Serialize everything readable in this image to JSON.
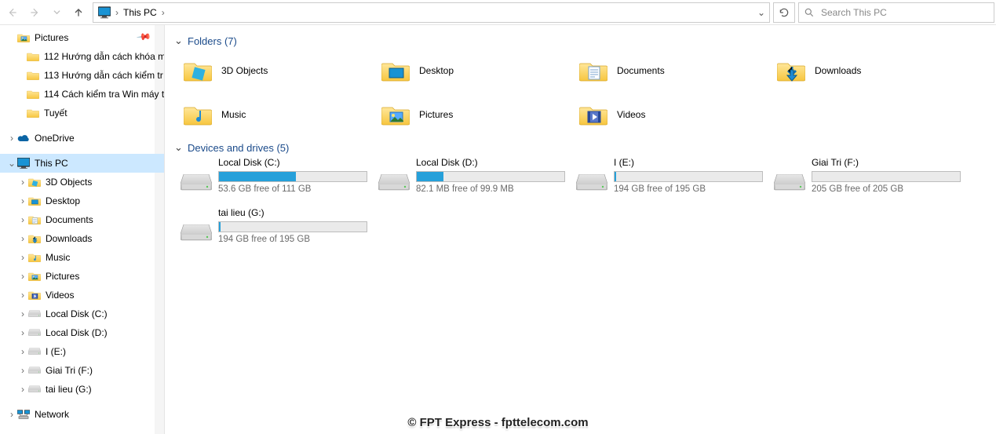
{
  "address": {
    "location_label": "This PC",
    "search_placeholder": "Search This PC"
  },
  "sidebar": {
    "pictures_label": "Pictures",
    "quick_items": [
      {
        "label": "112 Hướng dẫn cách khóa m"
      },
      {
        "label": "113 Hướng dẫn cách kiểm tr"
      },
      {
        "label": "114 Cách kiểm tra Win máy t"
      },
      {
        "label": "Tuyết"
      }
    ],
    "onedrive_label": "OneDrive",
    "this_pc_label": "This PC",
    "this_pc_children": [
      {
        "label": "3D Objects",
        "kind": "3d"
      },
      {
        "label": "Desktop",
        "kind": "desktop"
      },
      {
        "label": "Documents",
        "kind": "docs"
      },
      {
        "label": "Downloads",
        "kind": "downloads"
      },
      {
        "label": "Music",
        "kind": "music"
      },
      {
        "label": "Pictures",
        "kind": "pictures"
      },
      {
        "label": "Videos",
        "kind": "videos"
      },
      {
        "label": "Local Disk (C:)",
        "kind": "drive-c"
      },
      {
        "label": "Local Disk (D:)",
        "kind": "drive"
      },
      {
        "label": "I (E:)",
        "kind": "drive"
      },
      {
        "label": "Giai Tri (F:)",
        "kind": "drive"
      },
      {
        "label": "tai lieu (G:)",
        "kind": "drive"
      }
    ],
    "network_label": "Network"
  },
  "groups": {
    "folders_header": "Folders (7)",
    "drives_header": "Devices and drives (5)"
  },
  "folders": [
    {
      "label": "3D Objects",
      "kind": "3d"
    },
    {
      "label": "Desktop",
      "kind": "desktop"
    },
    {
      "label": "Documents",
      "kind": "docs"
    },
    {
      "label": "Downloads",
      "kind": "downloads"
    },
    {
      "label": "Music",
      "kind": "music"
    },
    {
      "label": "Pictures",
      "kind": "pictures"
    },
    {
      "label": "Videos",
      "kind": "videos"
    }
  ],
  "drives": [
    {
      "name": "Local Disk (C:)",
      "space": "53.6 GB free of 111 GB",
      "fill_pct": 52,
      "os": true
    },
    {
      "name": "Local Disk (D:)",
      "space": "82.1 MB free of 99.9 MB",
      "fill_pct": 18,
      "os": false
    },
    {
      "name": "I (E:)",
      "space": "194 GB free of 195 GB",
      "fill_pct": 1,
      "os": false
    },
    {
      "name": "Giai Tri (F:)",
      "space": "205 GB free of 205 GB",
      "fill_pct": 0,
      "os": false
    },
    {
      "name": "tai lieu (G:)",
      "space": "194 GB free of 195 GB",
      "fill_pct": 1,
      "os": false
    }
  ],
  "watermark": "© FPT Express - fpttelecom.com"
}
